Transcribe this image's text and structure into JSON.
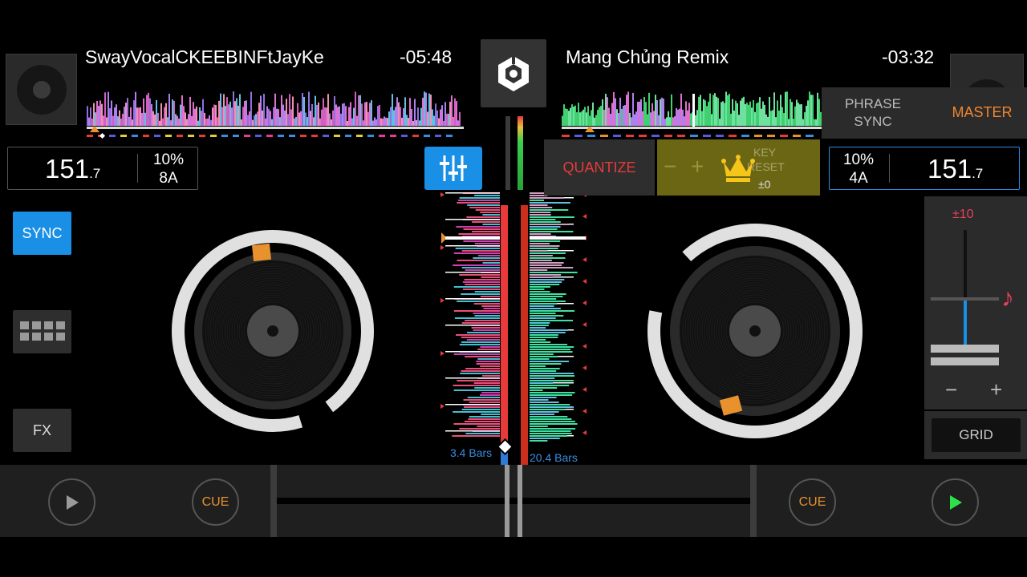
{
  "deck_a": {
    "title": "SwayVocalCKEEBINFtJayKe",
    "remaining": "-05:48",
    "bpm_int": "151",
    "bpm_dec": ".7",
    "pitch_range": "10%",
    "key": "8A",
    "sync_label": "SYNC",
    "fx_label": "FX",
    "cue_label": "CUE",
    "bars": "3.4 Bars"
  },
  "deck_b": {
    "title": "Mang Chủng Remix",
    "remaining": "-03:32",
    "bpm_int": "151",
    "bpm_dec": ".7",
    "pitch_range": "10%",
    "key": "4A",
    "cue_label": "CUE",
    "bars": "20.4 Bars",
    "phrase_sync_line1": "PHRASE",
    "phrase_sync_line2": "SYNC",
    "master_label": "MASTER",
    "quantize_label": "QUANTIZE",
    "key_label": "KEY",
    "reset_label": "RESET",
    "key_shift": "±0",
    "tempo_range": "±10",
    "grid_label": "GRID",
    "minus": "−",
    "plus": "+"
  },
  "colors": {
    "accent_blue": "#1a8fe6",
    "cue_orange": "#e8922e",
    "quantize_red": "#e83a3a",
    "master_orange": "#f0852f",
    "key_panel": "#6b6614",
    "crown": "#f5c518"
  },
  "icons": {
    "logo": "rekordbox-logo-icon",
    "mixer": "mixer-sliders-icon",
    "pads": "pad-grid-icon",
    "play": "play-icon",
    "crown": "crown-icon",
    "note": "music-note-icon"
  }
}
